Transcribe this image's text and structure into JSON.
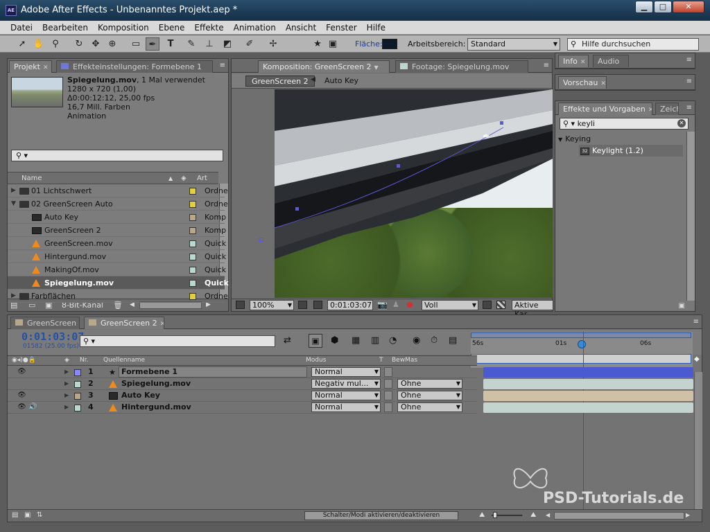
{
  "window": {
    "app_icon": "AE",
    "title": "Adobe After Effects - Unbenanntes Projekt.aep *",
    "minimize": "▁",
    "maximize": "□",
    "close": "✕"
  },
  "menu": [
    "Datei",
    "Bearbeiten",
    "Komposition",
    "Ebene",
    "Effekte",
    "Animation",
    "Ansicht",
    "Fenster",
    "Hilfe"
  ],
  "toolbar": {
    "flaeche_label": "Fläche:",
    "flaeche_color": "#0b1a2a",
    "workspace_label": "Arbeitsbereich:",
    "workspace_value": "Standard",
    "search_placeholder": "Hilfe durchsuchen"
  },
  "project_panel": {
    "tab_label": "Projekt",
    "effects_tab_label": "Effekteinstellungen: Formebene 1",
    "item_name": "Spiegelung.mov",
    "item_usage": ", 1 Mal verwendet",
    "info_lines": [
      "1280 x 720 (1,00)",
      "Δ0:00:12:12, 25,00 fps",
      "16,7 Mill. Farben",
      "Animation"
    ],
    "search_value": "",
    "col_name": "Name",
    "col_type": "Art",
    "rows": [
      {
        "name": "01 Lichtschwert",
        "type": "Ordne",
        "kind": "folder",
        "label_color": "#e0d040",
        "twirl": "▶",
        "indent": 0
      },
      {
        "name": "02 GreenScreen Auto",
        "type": "Ordne",
        "kind": "folder",
        "label_color": "#e0d040",
        "twirl": "▼",
        "indent": 0
      },
      {
        "name": "Auto Key",
        "type": "Komp",
        "kind": "comp",
        "label_color": "#b8a888",
        "twirl": "",
        "indent": 1
      },
      {
        "name": "GreenScreen 2",
        "type": "Komp",
        "kind": "comp",
        "label_color": "#b8a888",
        "twirl": "",
        "indent": 1
      },
      {
        "name": "GreenScreen.mov",
        "type": "Quick",
        "kind": "vlc",
        "label_color": "#b8d8d0",
        "twirl": "",
        "indent": 1
      },
      {
        "name": "Hintergund.mov",
        "type": "Quick",
        "kind": "vlc",
        "label_color": "#b8d8d0",
        "twirl": "",
        "indent": 1
      },
      {
        "name": "MakingOf.mov",
        "type": "Quick",
        "kind": "vlc",
        "label_color": "#b8d8d0",
        "twirl": "",
        "indent": 1
      },
      {
        "name": "Spiegelung.mov",
        "type": "Quick",
        "kind": "vlc",
        "label_color": "#b8d8d0",
        "twirl": "",
        "indent": 1,
        "selected": true
      },
      {
        "name": "Farbflächen",
        "type": "Ordne",
        "kind": "folder",
        "label_color": "#e0d040",
        "twirl": "▶",
        "indent": 0
      }
    ],
    "bit_depth": "8-Bit-Kanal"
  },
  "comp_panel": {
    "tab_label": "Komposition: GreenScreen 2",
    "footage_tab_label": "Footage: Spiegelung.mov",
    "crumb_active": "GreenScreen 2",
    "crumb_next": "Auto Key",
    "zoom": "100%",
    "timecode": "0:01:03:07",
    "resolution": "Voll",
    "camera": "Aktive Kar"
  },
  "right_panels": {
    "info_tab": "Info",
    "audio_tab": "Audio",
    "preview_tab": "Vorschau",
    "effects_tab": "Effekte und Vorgaben",
    "char_tab": "Zeich",
    "search_value": "keyli",
    "group": "Keying",
    "effect": "Keylight (1.2)"
  },
  "timeline": {
    "tabs": [
      "GreenScreen",
      "GreenScreen 2"
    ],
    "timecode": "0:01:03:07",
    "frames": "01582 (25.00 fps)",
    "search_value": "",
    "ruler": [
      "56s",
      "01s",
      "06s"
    ],
    "col_nr": "Nr.",
    "col_source": "Quellenname",
    "col_mode": "Modus",
    "col_t": "T",
    "col_matte": "BewMas",
    "layers": [
      {
        "num": "1",
        "name": "Formebene 1",
        "mode": "Normal",
        "matte": "",
        "color": "#8a8aff",
        "bar": "#4a5ad0",
        "kind": "shape",
        "eye": true,
        "audio": false
      },
      {
        "num": "2",
        "name": "Spiegelung.mov",
        "mode": "Negativ mul...",
        "matte": "Ohne",
        "color": "#b8d8d0",
        "bar": "#c3d3d0",
        "kind": "vlc",
        "eye": false,
        "audio": false
      },
      {
        "num": "3",
        "name": "Auto Key",
        "mode": "Normal",
        "matte": "Ohne",
        "color": "#b8a888",
        "bar": "#cfc0a6",
        "kind": "comp",
        "eye": true,
        "audio": false
      },
      {
        "num": "4",
        "name": "Hintergund.mov",
        "mode": "Normal",
        "matte": "Ohne",
        "color": "#b8d8d0",
        "bar": "#c3d3d0",
        "kind": "vlc",
        "eye": true,
        "audio": true
      }
    ],
    "footer_toggle": "Schalter/Modi aktivieren/deaktivieren",
    "playhead_color": "#d02020"
  },
  "watermark": "PSD-Tutorials.de"
}
